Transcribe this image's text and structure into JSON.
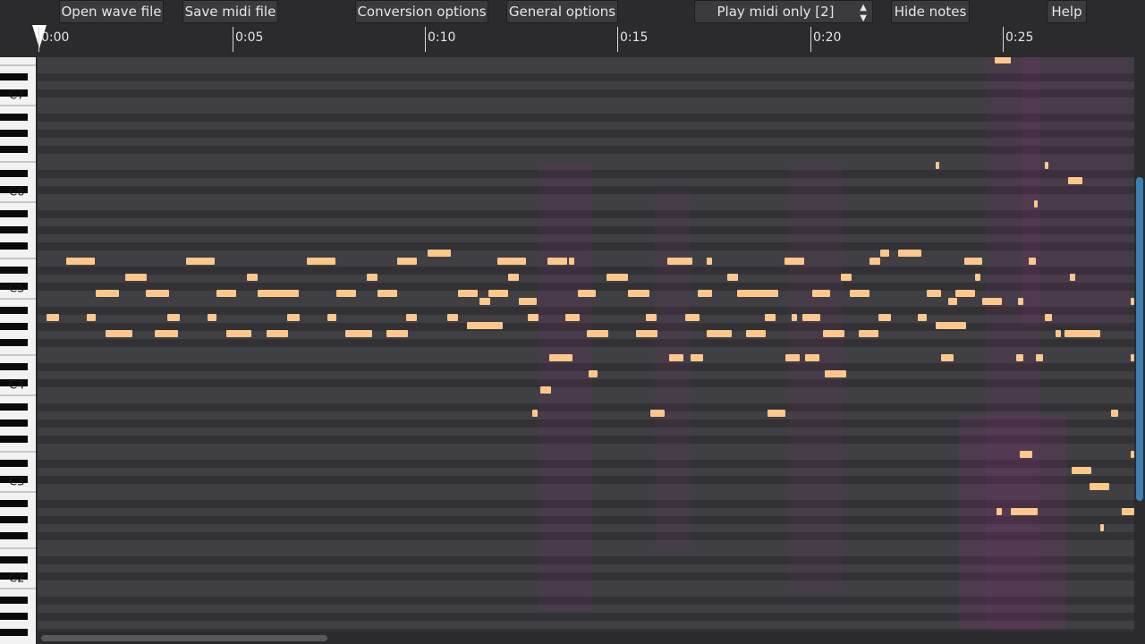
{
  "toolbar": {
    "open_wave": "Open wave file",
    "save_midi": "Save midi file",
    "conversion_options": "Conversion options",
    "general_options": "General options",
    "play_mode": "Play midi only [2]",
    "hide_notes": "Hide notes",
    "help": "Help"
  },
  "timeline": {
    "labels": [
      "0:00",
      "0:05",
      "0:10",
      "0:15",
      "0:20",
      "0:25"
    ]
  },
  "keyboard": {
    "octave_labels": [
      "C7",
      "C6",
      "C5",
      "C4",
      "C3",
      "C2"
    ]
  },
  "colors": {
    "note": "#ffc78a",
    "note_dim": "#f0a070",
    "lane_dark": "#323236",
    "lane_light": "#3f3f44",
    "scroll_thumb": "#3d7fb0"
  },
  "icons": {
    "playhead": "playhead-marker-icon",
    "select_arrows": "updown-arrows-icon"
  }
}
